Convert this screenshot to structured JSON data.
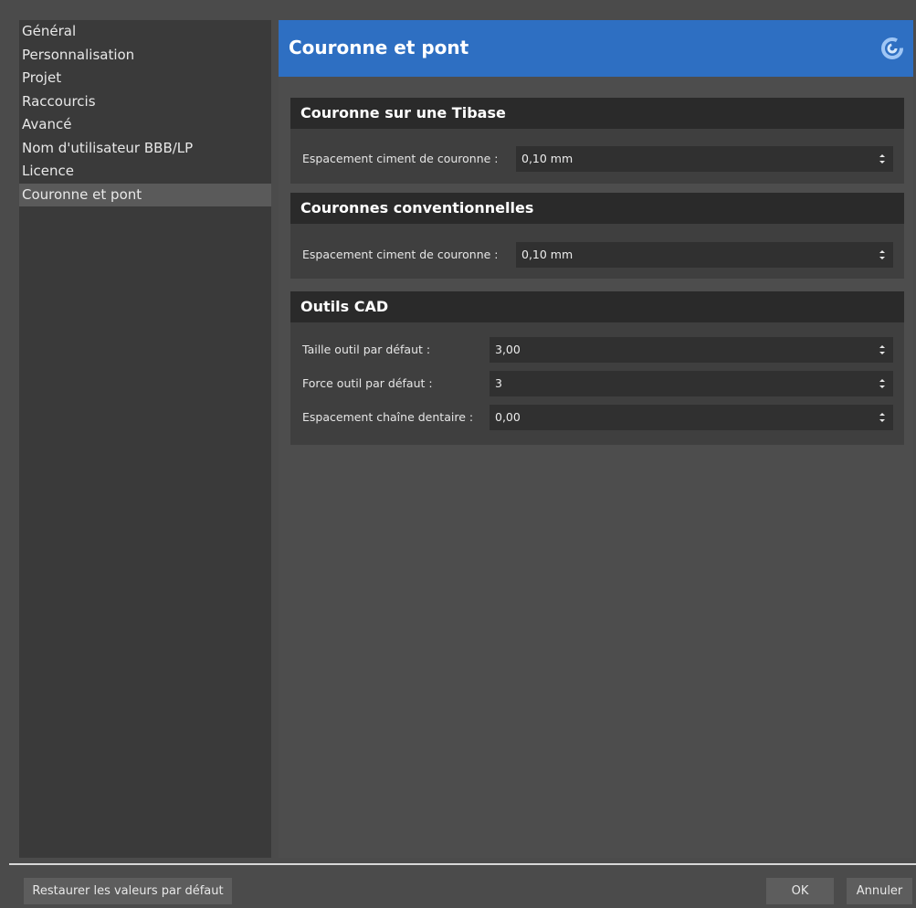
{
  "sidebar": {
    "items": [
      {
        "label": "Général",
        "selected": false
      },
      {
        "label": "Personnalisation",
        "selected": false
      },
      {
        "label": "Projet",
        "selected": false
      },
      {
        "label": "Raccourcis",
        "selected": false
      },
      {
        "label": "Avancé",
        "selected": false
      },
      {
        "label": "Nom d'utilisateur BBB/LP",
        "selected": false
      },
      {
        "label": "Licence",
        "selected": false
      },
      {
        "label": "Couronne et pont",
        "selected": true
      }
    ]
  },
  "header": {
    "title": "Couronne et pont",
    "logo_icon": "swirl-logo-icon"
  },
  "groups": [
    {
      "title": "Couronne sur une Tibase",
      "fields": [
        {
          "label": "Espacement ciment de couronne :",
          "value": "0,10 mm"
        }
      ]
    },
    {
      "title": "Couronnes conventionnelles",
      "fields": [
        {
          "label": "Espacement ciment de couronne :",
          "value": "0,10 mm"
        }
      ]
    },
    {
      "title": "Outils CAD",
      "fields": [
        {
          "label": "Taille outil par défaut :",
          "value": "3,00"
        },
        {
          "label": "Force outil par défaut :",
          "value": "3"
        },
        {
          "label": "Espacement chaîne dentaire :",
          "value": "0,00"
        }
      ]
    }
  ],
  "footer": {
    "restore_label": "Restaurer les valeurs par défaut",
    "ok_label": "OK",
    "cancel_label": "Annuler"
  },
  "colors": {
    "accent": "#2e6fc2",
    "background": "#4b4b4b",
    "sidebar": "#3a3a3a",
    "group_header": "#2a2a2a"
  }
}
